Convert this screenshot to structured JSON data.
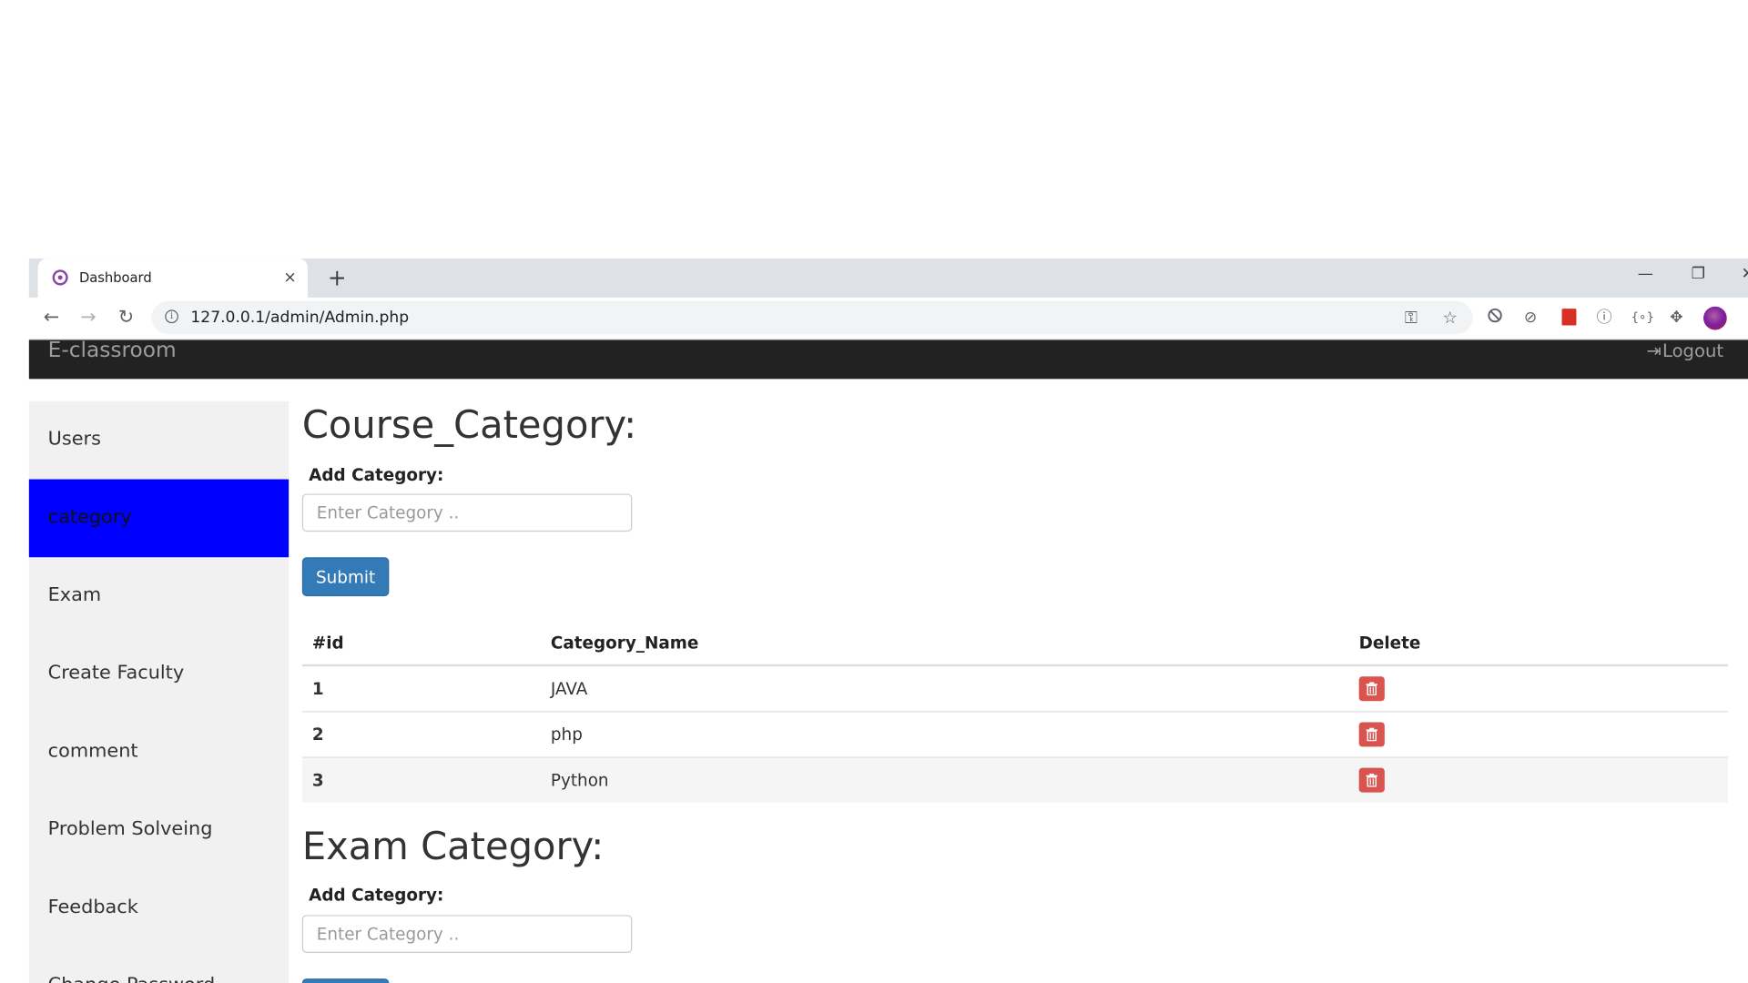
{
  "browser": {
    "tab_title": "Dashboard",
    "tab_close": "×",
    "new_tab": "+",
    "minimize": "—",
    "restore": "❐",
    "close": "✕",
    "back": "←",
    "forward": "→",
    "reload": "↻",
    "url": "127.0.0.1/admin/Admin.php",
    "key": "⚿",
    "star": "☆",
    "ext_block": "⃠",
    "ext_2": "⊘",
    "ext_3": "ⓘ",
    "ext_4": "{∘}",
    "puzzle": "✥"
  },
  "app": {
    "brand": "E-classroom",
    "logout_icon": "⇥",
    "logout": "Logout"
  },
  "sidebar": {
    "items": [
      {
        "label": "Users"
      },
      {
        "label": "category"
      },
      {
        "label": "Exam"
      },
      {
        "label": "Create Faculty"
      },
      {
        "label": "comment"
      },
      {
        "label": "Problem Solveing"
      },
      {
        "label": "Feedback"
      },
      {
        "label": "Change Password"
      }
    ],
    "active_color": "#0000ff"
  },
  "course": {
    "heading": "Course_Category:",
    "add_label": "Add Category:",
    "placeholder": "Enter Category ..",
    "submit": "Submit",
    "table": {
      "headers": [
        "#id",
        "Category_Name",
        "Delete"
      ],
      "rows": [
        {
          "id": "1",
          "name": "JAVA"
        },
        {
          "id": "2",
          "name": "php"
        },
        {
          "id": "3",
          "name": "Python"
        }
      ]
    }
  },
  "exam": {
    "heading": "Exam Category:",
    "add_label": "Add Category:",
    "placeholder": "Enter Category .."
  },
  "colors": {
    "navbar": "#222222",
    "primary_button": "#337ab7",
    "danger_button": "#d9534f"
  }
}
